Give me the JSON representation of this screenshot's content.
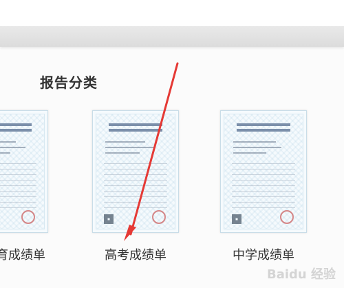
{
  "section": {
    "title": "报告分类"
  },
  "cards": [
    {
      "label": "育成绩单"
    },
    {
      "label": "高考成绩单"
    },
    {
      "label": "中学成绩单"
    }
  ],
  "watermark": "Baidu 经验",
  "colors": {
    "arrow": "#e53935",
    "title": "#333333"
  },
  "icons": {
    "arrow": "red-arrow-icon"
  }
}
